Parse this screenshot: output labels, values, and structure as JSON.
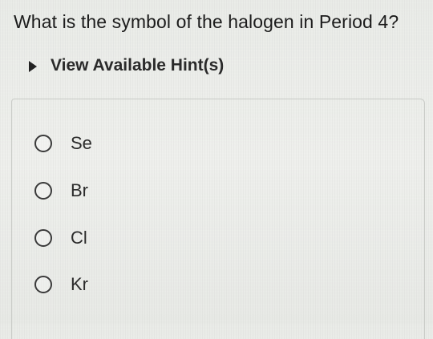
{
  "question": {
    "text": "What is the symbol of the halogen in Period 4?"
  },
  "hint": {
    "label": "View Available Hint(s)",
    "icon": "triangle-right-icon"
  },
  "options": [
    {
      "label": "Se",
      "selected": false
    },
    {
      "label": "Br",
      "selected": false
    },
    {
      "label": "Cl",
      "selected": false
    },
    {
      "label": "Kr",
      "selected": false
    }
  ]
}
